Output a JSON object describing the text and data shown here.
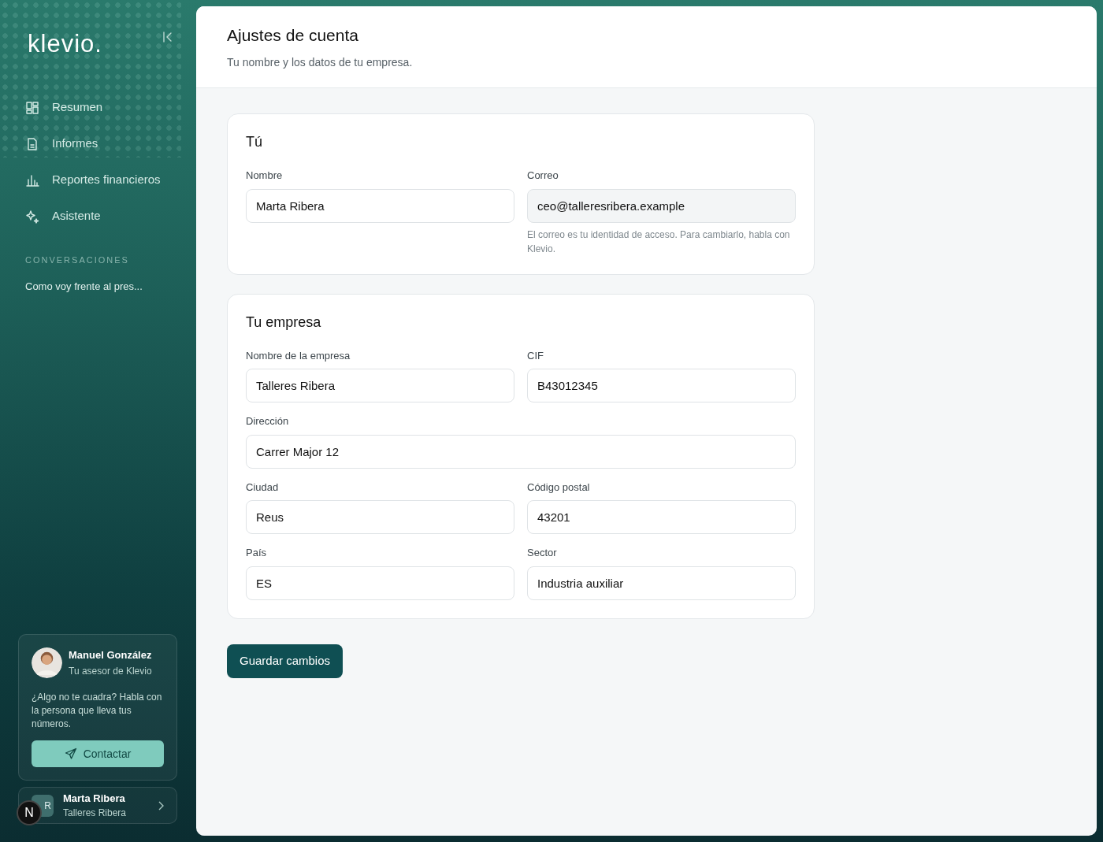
{
  "sidebar": {
    "logo": "klevio.",
    "nav": [
      {
        "label": "Resumen"
      },
      {
        "label": "Informes"
      },
      {
        "label": "Reportes financieros"
      },
      {
        "label": "Asistente"
      }
    ],
    "section_title": "CONVERSACIONES",
    "conversations": [
      "Como voy frente al pres..."
    ],
    "advisor": {
      "name": "Manuel González",
      "role": "Tu asesor de Klevio",
      "message": "¿Algo no te cuadra? Habla con la persona que lleva tus números.",
      "button": "Contactar"
    },
    "account": {
      "initials": "R",
      "name": "Marta Ribera",
      "company": "Talleres Ribera"
    }
  },
  "dev_badge": "N",
  "header": {
    "title": "Ajustes de cuenta",
    "subtitle": "Tu nombre y los datos de tu empresa."
  },
  "sections": [
    {
      "title": "Tú",
      "rows": [
        [
          {
            "label": "Nombre",
            "value": "Marta Ribera",
            "disabled": false
          },
          {
            "label": "Correo",
            "value": "ceo@talleresribera.example",
            "disabled": true,
            "help": "El correo es tu identidad de acceso. Para cambiarlo, habla con Klevio."
          }
        ]
      ]
    },
    {
      "title": "Tu empresa",
      "rows": [
        [
          {
            "label": "Nombre de la empresa",
            "value": "Talleres Ribera",
            "disabled": false
          },
          {
            "label": "CIF",
            "value": "B43012345",
            "disabled": false
          }
        ],
        [
          {
            "label": "Dirección",
            "value": "Carrer Major 12",
            "disabled": false
          }
        ],
        [
          {
            "label": "Ciudad",
            "value": "Reus",
            "disabled": false
          },
          {
            "label": "Código postal",
            "value": "43201",
            "disabled": false
          }
        ],
        [
          {
            "label": "País",
            "value": "ES",
            "disabled": false
          },
          {
            "label": "Sector",
            "value": "Industria auxiliar",
            "disabled": false
          }
        ]
      ]
    }
  ],
  "save_button": "Guardar cambios"
}
